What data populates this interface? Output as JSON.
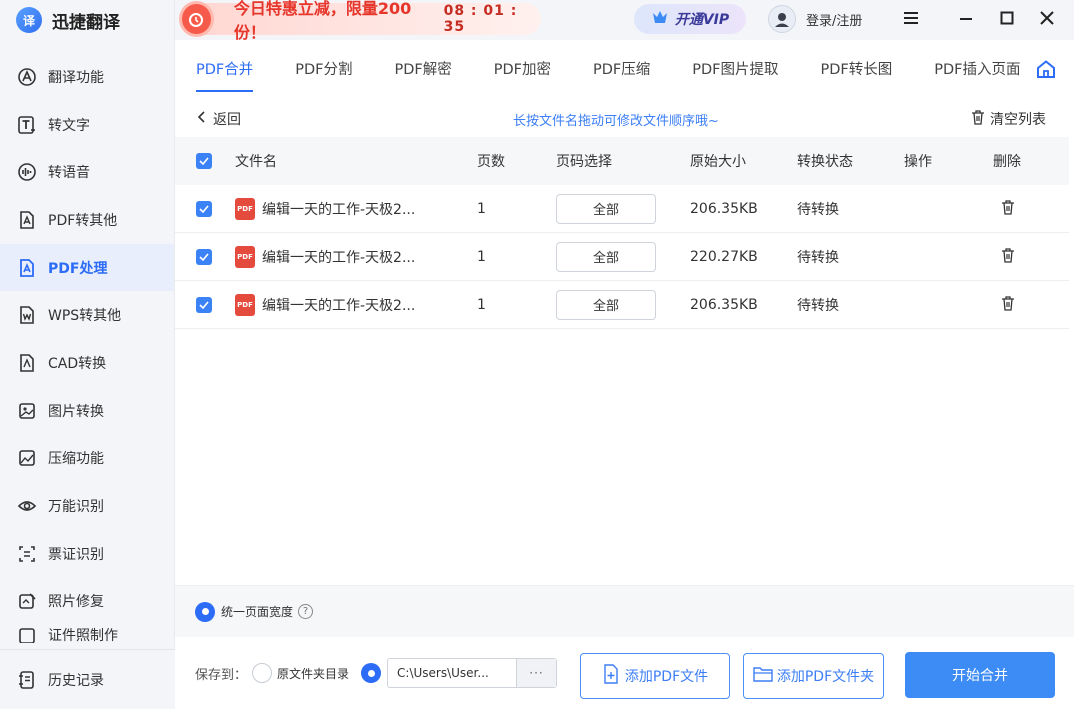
{
  "app": {
    "logo_text": "译",
    "name": "迅捷翻译"
  },
  "promo": {
    "text": "今日特惠立减，限量200份！",
    "countdown": "08 : 01 : 35"
  },
  "header": {
    "vip_label": "开通VIP",
    "login_label": "登录/注册"
  },
  "sidebar": {
    "items": [
      {
        "label": "翻译功能",
        "icon": "translate-icon"
      },
      {
        "label": "转文字",
        "icon": "text-icon"
      },
      {
        "label": "转语音",
        "icon": "voice-icon"
      },
      {
        "label": "PDF转其他",
        "icon": "pdf-convert-icon"
      },
      {
        "label": "PDF处理",
        "icon": "pdf-process-icon",
        "active": true
      },
      {
        "label": "WPS转其他",
        "icon": "wps-icon"
      },
      {
        "label": "CAD转换",
        "icon": "cad-icon"
      },
      {
        "label": "图片转换",
        "icon": "image-icon"
      },
      {
        "label": "压缩功能",
        "icon": "compress-icon"
      },
      {
        "label": "万能识别",
        "icon": "eye-icon"
      },
      {
        "label": "票证识别",
        "icon": "ticket-icon"
      },
      {
        "label": "照片修复",
        "icon": "photo-fix-icon"
      },
      {
        "label": "证件照制作",
        "icon": "id-photo-icon"
      }
    ],
    "history_label": "历史记录"
  },
  "tabs": [
    "PDF合并",
    "PDF分割",
    "PDF解密",
    "PDF加密",
    "PDF压缩",
    "PDF图片提取",
    "PDF转长图",
    "PDF插入页面"
  ],
  "toolbar": {
    "back_label": "返回",
    "hint": "长按文件名拖动可修改文件顺序哦~",
    "clear_label": "清空列表"
  },
  "table": {
    "headers": [
      "文件名",
      "页数",
      "页码选择",
      "原始大小",
      "转换状态",
      "操作",
      "删除"
    ],
    "rows": [
      {
        "name": "编辑一天的工作-天极2...",
        "pages": "1",
        "range": "全部",
        "size": "206.35KB",
        "status": "待转换"
      },
      {
        "name": "编辑一天的工作-天极2...",
        "pages": "1",
        "range": "全部",
        "size": "220.27KB",
        "status": "待转换"
      },
      {
        "name": "编辑一天的工作-天极2...",
        "pages": "1",
        "range": "全部",
        "size": "206.35KB",
        "status": "待转换"
      }
    ]
  },
  "options": {
    "uniform_width_label": "统一页面宽度",
    "help": "?"
  },
  "footer": {
    "save_label": "保存到：",
    "source_dir_label": "原文件夹目录",
    "path": "C:\\Users\\User...",
    "more": "···",
    "add_file_label": "添加PDF文件",
    "add_folder_label": "添加PDF文件夹",
    "start_label": "开始合并"
  },
  "colors": {
    "accent": "#2c6cf6",
    "promo_red": "#e6362b",
    "pdf_red": "#e54b3c"
  }
}
